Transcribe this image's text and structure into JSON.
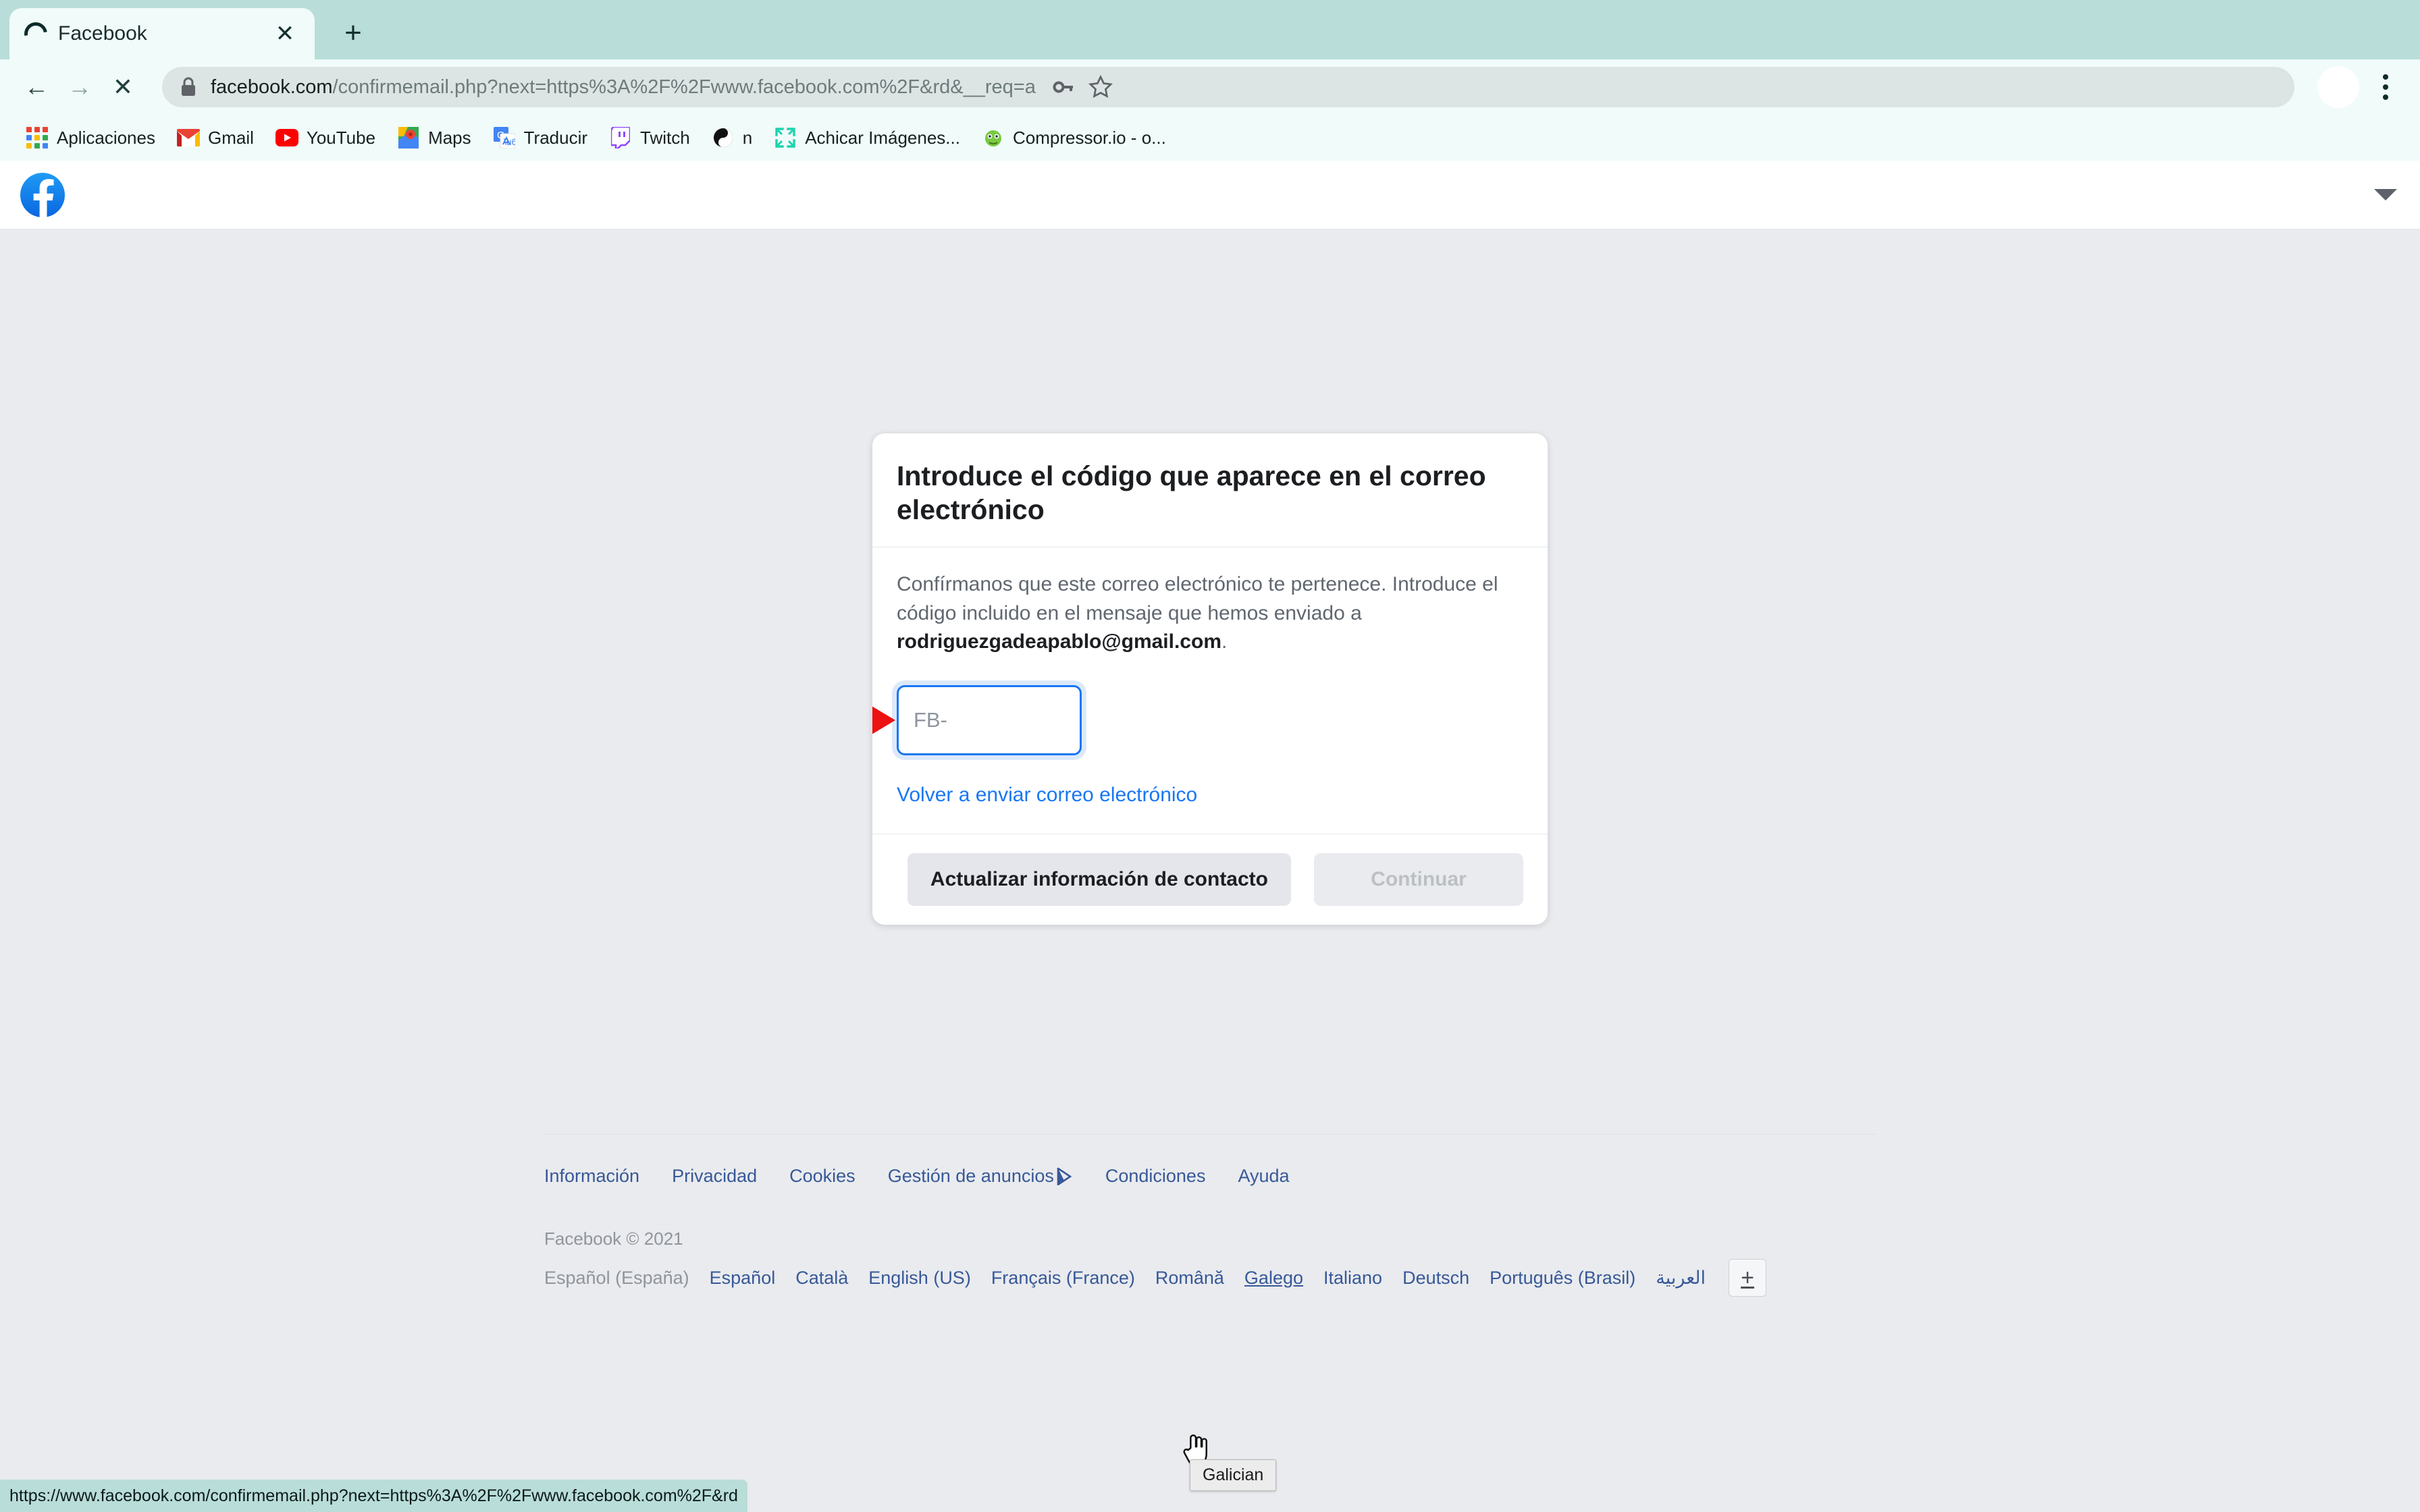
{
  "browser": {
    "tab": {
      "title": "Facebook",
      "spinner": "loading-spinner",
      "close_label": "✕"
    },
    "new_tab_label": "+",
    "nav": {
      "back": "←",
      "forward": "→",
      "stop": "✕"
    },
    "omnibox": {
      "lock_icon": "lock-icon",
      "url_host": "facebook.com",
      "url_path": "/confirmemail.php?next=https%3A%2F%2Fwww.facebook.com%2F&rd&__req=a",
      "key_icon": "key-icon",
      "star_icon": "star-icon"
    },
    "menu_icon": "kebab-menu-icon",
    "avatar": "profile-avatar",
    "bookmarks": [
      {
        "label": "Aplicaciones",
        "icon": "apps-grid-icon"
      },
      {
        "label": "Gmail",
        "icon": "gmail-icon"
      },
      {
        "label": "YouTube",
        "icon": "youtube-icon"
      },
      {
        "label": "Maps",
        "icon": "maps-icon"
      },
      {
        "label": "Traducir",
        "icon": "translate-icon"
      },
      {
        "label": "Twitch",
        "icon": "twitch-icon"
      },
      {
        "label": "n",
        "icon": "yin-yang-icon"
      },
      {
        "label": "Achicar Imágenes...",
        "icon": "resize-icon"
      },
      {
        "label": "Compressor.io - o...",
        "icon": "compressor-icon"
      }
    ],
    "status_url": "https://www.facebook.com/confirmemail.php?next=https%3A%2F%2Fwww.facebook.com%2F&rd"
  },
  "page_header": {
    "logo": "facebook-logo",
    "caret": "chevron-down-icon"
  },
  "card": {
    "title": "Introduce el código que aparece en el correo electrónico",
    "desc_part1": "Confírmanos que este correo electrónico te pertenece. Introduce el código incluido en el mensaje que hemos enviado a ",
    "desc_email": "rodriguezgadeapablo@gmail.com",
    "desc_part2": ".",
    "code_placeholder": "FB-",
    "code_value": "",
    "resend_label": "Volver a enviar correo electrónico",
    "update_contact_label": "Actualizar información de contacto",
    "continue_label": "Continuar",
    "accent_color": "#1877f2"
  },
  "footer": {
    "links": [
      {
        "label": "Información",
        "icon": null
      },
      {
        "label": "Privacidad",
        "icon": null
      },
      {
        "label": "Cookies",
        "icon": null
      },
      {
        "label": "Gestión de anuncios",
        "icon": "adchoices-icon"
      },
      {
        "label": "Condiciones",
        "icon": null
      },
      {
        "label": "Ayuda",
        "icon": null
      }
    ],
    "copyright": "Facebook © 2021",
    "languages": [
      {
        "label": "Español (España)",
        "state": "current"
      },
      {
        "label": "Español",
        "state": "normal"
      },
      {
        "label": "Català",
        "state": "normal"
      },
      {
        "label": "English (US)",
        "state": "normal"
      },
      {
        "label": "Français (France)",
        "state": "normal"
      },
      {
        "label": "Română",
        "state": "normal"
      },
      {
        "label": "Galego",
        "state": "hover"
      },
      {
        "label": "Italiano",
        "state": "normal"
      },
      {
        "label": "Deutsch",
        "state": "normal"
      },
      {
        "label": "Português (Brasil)",
        "state": "normal"
      },
      {
        "label": "العربية",
        "state": "normal"
      }
    ],
    "more_languages_label": "+"
  },
  "tooltip": {
    "text": "Galician"
  }
}
